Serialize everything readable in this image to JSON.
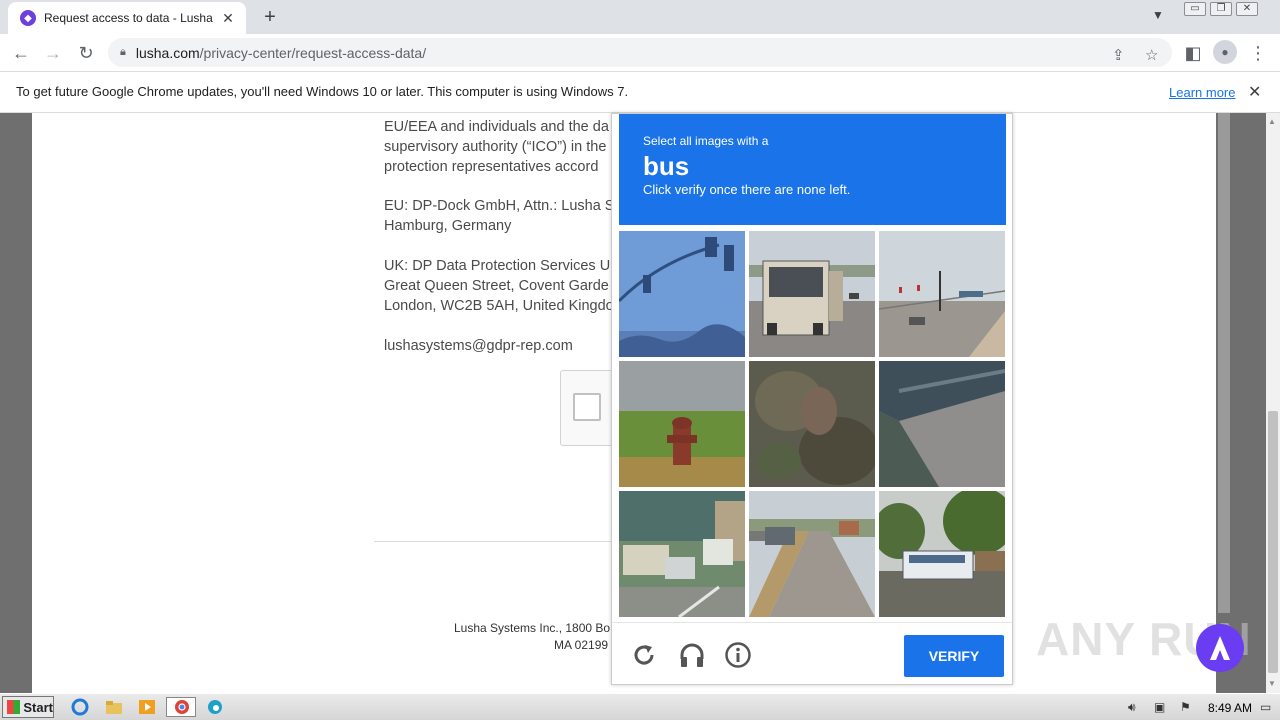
{
  "browser": {
    "tab_title": "Request access to data - Lusha",
    "url_domain": "lusha.com",
    "url_path": "/privacy-center/request-access-data/"
  },
  "infobar": {
    "message": "To get future Google Chrome updates, you'll need Windows 10 or later. This computer is using Windows 7.",
    "learn_more": "Learn more"
  },
  "page": {
    "lines": [
      "EU/EEA and individuals and the da",
      "supervisory authority (“ICO”) in the",
      "protection representatives accord",
      "EU: DP-Dock GmbH, Attn.: Lusha Sy",
      "Hamburg, Germany",
      "UK: DP Data Protection Services UK",
      "Great Queen Street, Covent Garde",
      "London, WC2B 5AH, United Kingdo",
      "lushasystems@gdpr-rep.com"
    ],
    "footer_line1": "Lusha Systems Inc., 1800 Bo",
    "footer_line2": "MA 02199"
  },
  "captcha": {
    "instruction": "Select all images with a",
    "target": "bus",
    "sub_instruction": "Click verify once there are none left.",
    "verify_label": "VERIFY",
    "tiles": [
      "traffic-light-sky",
      "bus-rear-road",
      "intersection-traffic-lights",
      "fire-hydrant-field",
      "blurred-foliage",
      "bridge-overpass",
      "buses-parking-lot",
      "street-cars-houses",
      "white-bus-trees"
    ]
  },
  "watermark": "ANY RUN",
  "taskbar": {
    "start_label": "Start",
    "clock": "8:49 AM"
  },
  "colors": {
    "captcha_blue": "#1a73e8",
    "chat_purple": "#6a3df2"
  }
}
